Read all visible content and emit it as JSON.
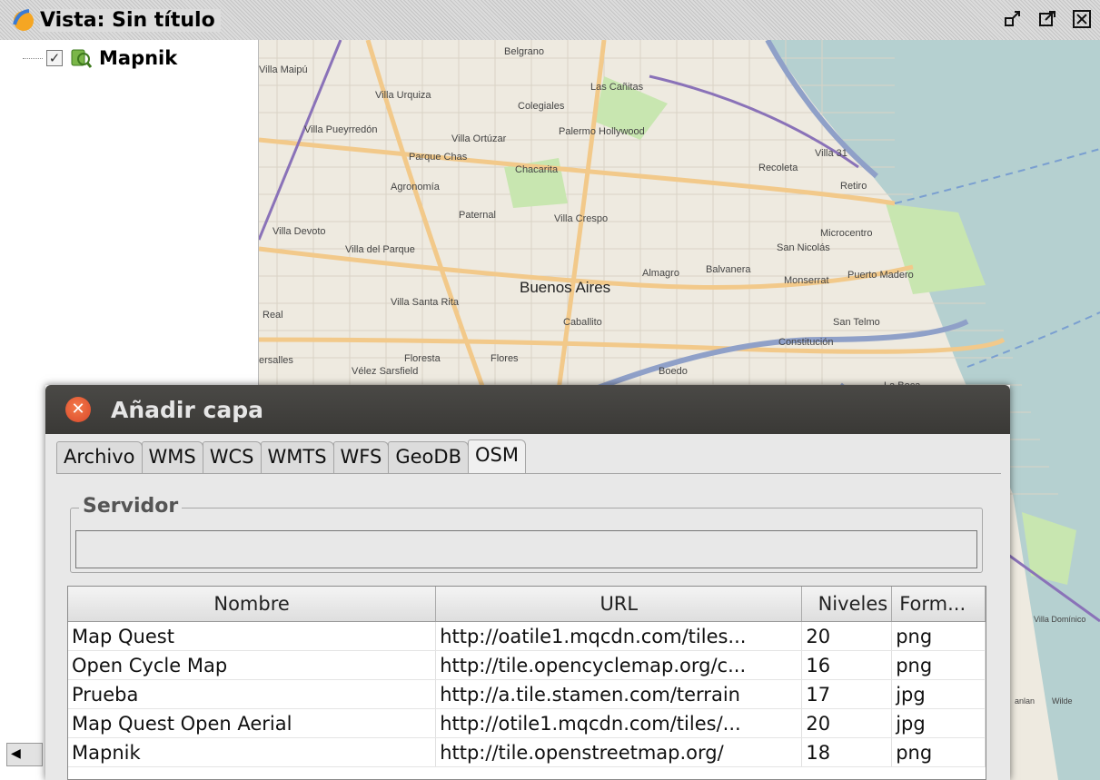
{
  "view": {
    "title": "Vista: Sin título",
    "title_icon": "gvsig-view-icon"
  },
  "window_buttons": [
    {
      "name": "restore-icon",
      "glyph": "⤡"
    },
    {
      "name": "maximize-icon",
      "glyph": "⤢"
    },
    {
      "name": "close-icon",
      "glyph": "☒"
    }
  ],
  "toc": {
    "layers": [
      {
        "label": "Mapnik",
        "checked": true,
        "icon": "layer-map-icon"
      }
    ]
  },
  "map": {
    "labels": [
      {
        "text": "Belgrano"
      },
      {
        "text": "Villa Maipú"
      },
      {
        "text": "Villa Urquiza"
      },
      {
        "text": "Las Cañitas"
      },
      {
        "text": "Colegiales"
      },
      {
        "text": "Villa Pueyrredón"
      },
      {
        "text": "Villa Ortúzar"
      },
      {
        "text": "Palermo Hollywood"
      },
      {
        "text": "Parque Chas"
      },
      {
        "text": "Chacarita"
      },
      {
        "text": "Villa 31"
      },
      {
        "text": "Recoleta"
      },
      {
        "text": "Agronomía"
      },
      {
        "text": "Retiro"
      },
      {
        "text": "Paternal"
      },
      {
        "text": "Villa Crespo"
      },
      {
        "text": "Villa Devoto"
      },
      {
        "text": "Microcentro"
      },
      {
        "text": "San Nicolás"
      },
      {
        "text": "Villa del Parque"
      },
      {
        "text": "Almagro"
      },
      {
        "text": "Balvanera"
      },
      {
        "text": "Monserrat"
      },
      {
        "text": "Puerto Madero"
      },
      {
        "text": "Buenos Aires"
      },
      {
        "text": "Villa Santa Rita"
      },
      {
        "text": "Real"
      },
      {
        "text": "Caballito"
      },
      {
        "text": "San Telmo"
      },
      {
        "text": "Constitución"
      },
      {
        "text": "Floresta"
      },
      {
        "text": "Flores"
      },
      {
        "text": "ersalles"
      },
      {
        "text": "Vélez Sarsfield"
      },
      {
        "text": "Boedo"
      },
      {
        "text": "La Boca"
      },
      {
        "text": "Villa Domínico"
      },
      {
        "text": "Wilde"
      },
      {
        "text": "anlan"
      }
    ]
  },
  "dialog": {
    "title": "Añadir capa",
    "tabs": [
      "Archivo",
      "WMS",
      "WCS",
      "WMTS",
      "WFS",
      "GeoDB",
      "OSM"
    ],
    "active_tab": "OSM",
    "server_legend": "Servidor",
    "server_value": "",
    "table": {
      "headers": [
        "Nombre",
        "URL",
        "Niveles",
        "Form..."
      ],
      "rows": [
        [
          "Map Quest",
          "http://oatile1.mqcdn.com/tiles...",
          "20",
          "png"
        ],
        [
          "Open Cycle Map",
          "http://tile.opencyclemap.org/c...",
          "16",
          "png"
        ],
        [
          "Prueba",
          "http://a.tile.stamen.com/terrain",
          "17",
          "jpg"
        ],
        [
          "Map Quest Open Aerial",
          "http://otile1.mqcdn.com/tiles/...",
          "20",
          "jpg"
        ],
        [
          "Mapnik",
          "http://tile.openstreetmap.org/",
          "18",
          "png"
        ]
      ]
    }
  },
  "colors": {
    "map_land": "#eeeae0",
    "map_water": "#b5d0d0",
    "map_park": "#c8e6b0",
    "map_road_major": "#f2c98a",
    "map_road_rail": "#8a72b8",
    "map_highway": "#8fa0c8",
    "dialog_title_bar": "#3e3d39",
    "dialog_close": "#e45a35"
  }
}
